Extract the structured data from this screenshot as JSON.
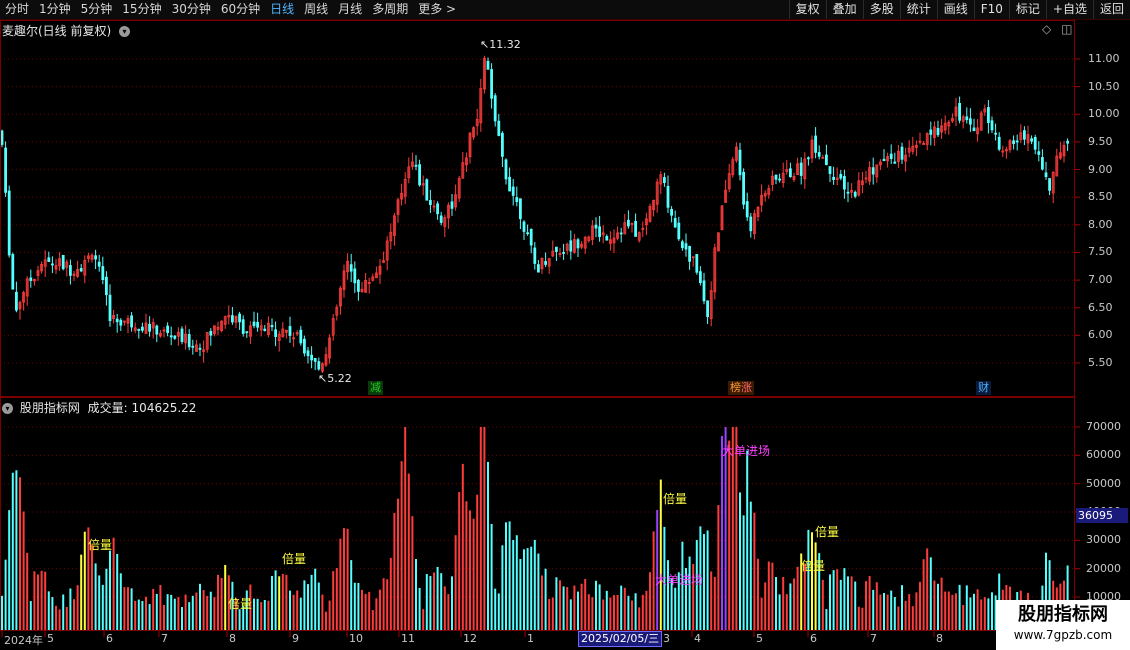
{
  "toolbar": {
    "periods": [
      "分时",
      "1分钟",
      "5分钟",
      "15分钟",
      "30分钟",
      "60分钟",
      "日线",
      "周线",
      "月线",
      "多周期",
      "更多 >"
    ],
    "active": "日线",
    "buttons": [
      "复权",
      "叠加",
      "多股",
      "统计",
      "画线",
      "F10",
      "标记",
      "+自选",
      "返回"
    ]
  },
  "price_pane": {
    "title": "麦趣尔(日线 前复权)",
    "high_label": "11.32",
    "low_label": "5.22",
    "y_ticks": [
      "11.00",
      "10.50",
      "10.00",
      "9.50",
      "9.00",
      "8.50",
      "8.00",
      "7.50",
      "7.00",
      "6.50",
      "6.00",
      "5.50"
    ],
    "markers": [
      {
        "text": "减",
        "color": "#22cc22"
      },
      {
        "text": "榜",
        "color": "#ff9a3c"
      },
      {
        "text": "涨",
        "color": "#ff6666"
      },
      {
        "text": "财",
        "color": "#4fb3ff"
      }
    ]
  },
  "volume_pane": {
    "title": "股朋指标网",
    "label": "成交量:",
    "value": "104625.22",
    "y_ticks": [
      "70000",
      "60000",
      "50000",
      "40000",
      "30000",
      "20000",
      "10000"
    ],
    "current_tag": "36095",
    "annotations": [
      {
        "text": "倍量",
        "color": "#ffff40"
      },
      {
        "text": "倍量",
        "color": "#ffff40"
      },
      {
        "text": "倍量",
        "color": "#ffff40"
      },
      {
        "text": "倍量",
        "color": "#ffff40"
      },
      {
        "text": "大单进场",
        "color": "#ff40ff"
      },
      {
        "text": "大单进场",
        "color": "#ff40ff"
      },
      {
        "text": "倍量",
        "color": "#ffff40"
      },
      {
        "text": "倍量",
        "color": "#ffff40"
      }
    ]
  },
  "x_axis": {
    "labels": [
      "2024年",
      "5",
      "6",
      "7",
      "8",
      "9",
      "10",
      "11",
      "12",
      "1",
      "2025/02/05/三",
      "3",
      "4",
      "5",
      "6",
      "7",
      "8"
    ]
  },
  "watermark": {
    "line1": "股朋指标网",
    "line2": "www.7gpzb.com"
  },
  "colors": {
    "up": "#ff3c3c",
    "down": "#54ffff",
    "grid": "#6a0000",
    "border": "#7a0000"
  }
}
